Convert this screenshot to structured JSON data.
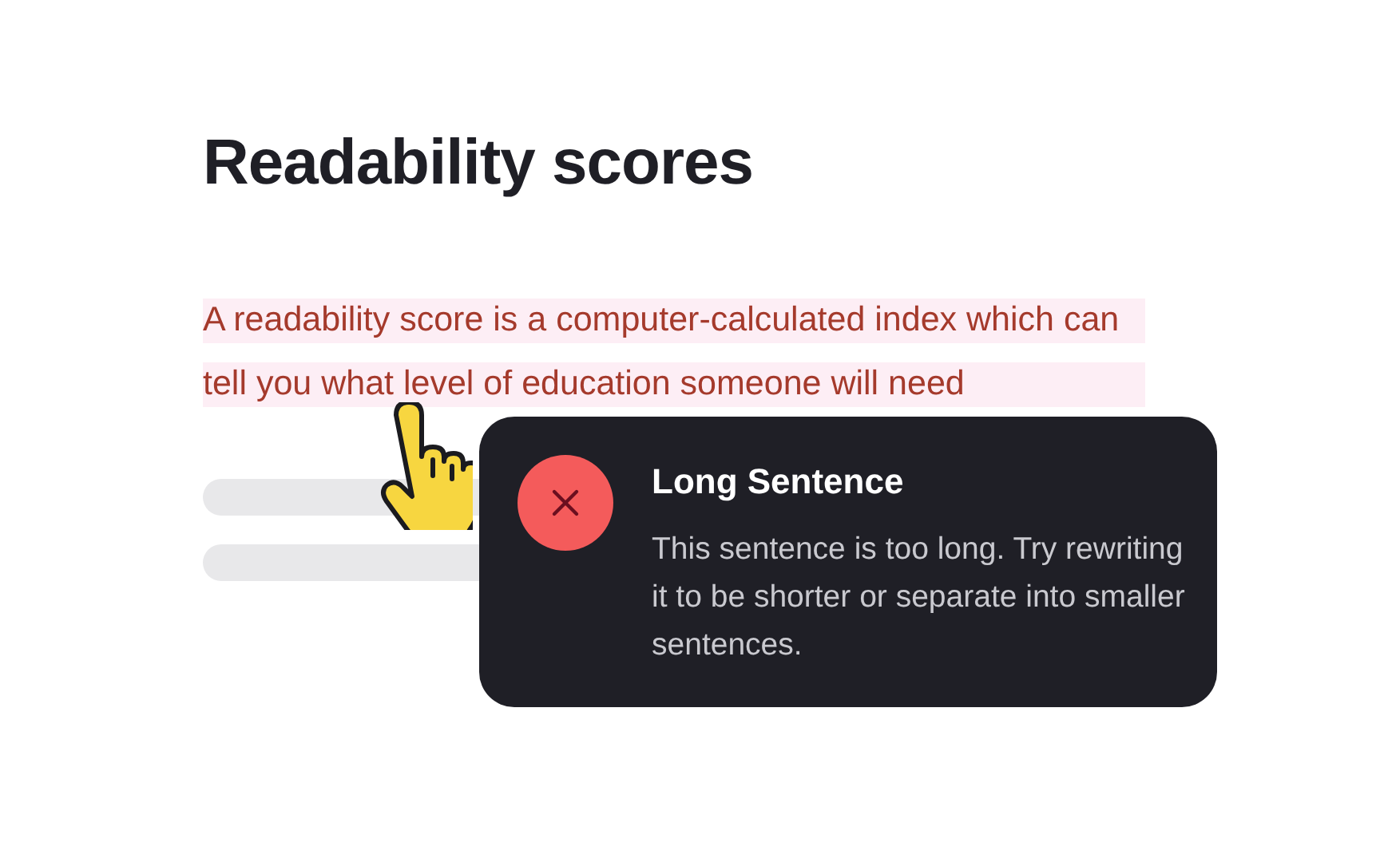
{
  "heading": "Readability scores",
  "paragraph": {
    "text": "A readability score is a computer-calculated index which can tell you what level of education someone will need",
    "flagged": true
  },
  "tooltip": {
    "title": "Long Sentence",
    "message": "This sentence is too long. Try rewriting it to be shorter or separate into smaller sentences."
  }
}
